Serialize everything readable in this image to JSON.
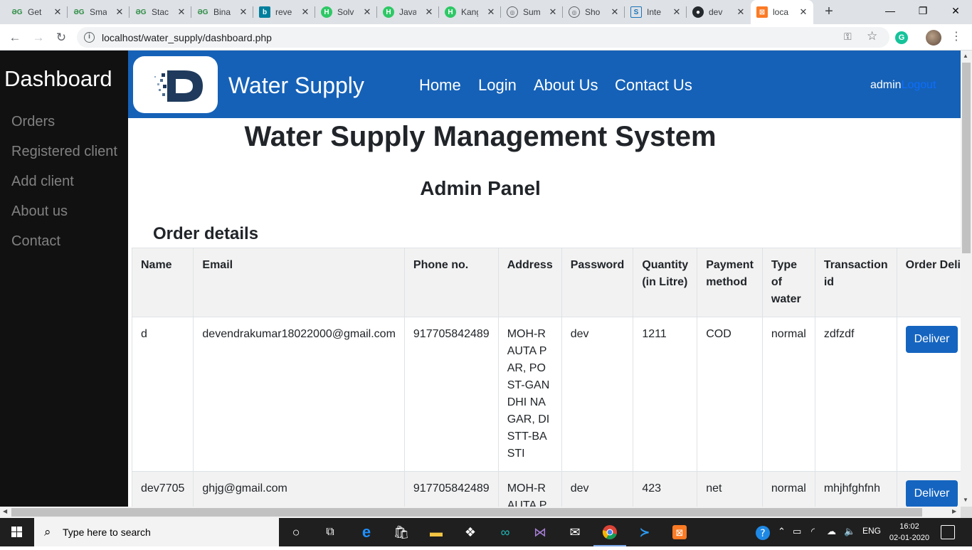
{
  "browser": {
    "tabs": [
      {
        "title": "Get",
        "icon": "geeksforgeeks-icon"
      },
      {
        "title": "Sma",
        "icon": "geeksforgeeks-icon"
      },
      {
        "title": "Stac",
        "icon": "geeksforgeeks-icon"
      },
      {
        "title": "Bina",
        "icon": "geeksforgeeks-icon"
      },
      {
        "title": "reve",
        "icon": "bing-icon"
      },
      {
        "title": "Solv",
        "icon": "hackerrank-icon"
      },
      {
        "title": "Java",
        "icon": "hackerrank-icon"
      },
      {
        "title": "Kang",
        "icon": "hackerrank-icon"
      },
      {
        "title": "Sum",
        "icon": "globe-icon"
      },
      {
        "title": "Sho",
        "icon": "globe-icon"
      },
      {
        "title": "Inte",
        "icon": "interviewbit-icon"
      },
      {
        "title": "dev",
        "icon": "github-icon"
      },
      {
        "title": "loca",
        "icon": "xampp-icon"
      }
    ],
    "url": "localhost/water_supply/dashboard.php"
  },
  "sidebar": {
    "brand": "Dashboard",
    "items": [
      "Orders",
      "Registered client",
      "Add client",
      "About us",
      "Contact"
    ]
  },
  "header": {
    "site_title": "Water Supply",
    "nav": [
      "Home",
      "Login",
      "About Us",
      "Contact Us"
    ],
    "user": "admin",
    "logout": "Logout"
  },
  "main": {
    "title": "Water Supply Management System",
    "panel_title": "Admin Panel",
    "section_title": "Order details"
  },
  "orders": {
    "columns": [
      "Name",
      "Email",
      "Phone no.",
      "Address",
      "Password",
      "Quantity (in Litre)",
      "Payment method",
      "Type of water",
      "Transaction id",
      "Order Deliverd"
    ],
    "rows": [
      {
        "name": "d",
        "email": "devendrakumar18022000@gmail.com",
        "phone": "917705842489",
        "address": "MOH-RAUTA PAR, POST-GANDHI NAGAR, DISTT-BASTI",
        "password": "dev",
        "quantity": "1211",
        "payment": "COD",
        "water_type": "normal",
        "transaction": "zdfzdf",
        "action": "Deliver"
      },
      {
        "name": "dev7705",
        "email": "ghjg@gmail.com",
        "phone": "917705842489",
        "address": "MOH-RAUTA PAR",
        "password": "dev",
        "quantity": "423",
        "payment": "net",
        "water_type": "normal",
        "transaction": "mhjhfghfnh",
        "action": "Deliver"
      }
    ]
  },
  "taskbar": {
    "search_placeholder": "Type here to search",
    "language": "ENG",
    "time": "16:02",
    "date": "02-01-2020"
  },
  "colors": {
    "header_bg": "#1561b7",
    "sidebar_bg": "#111111",
    "button_bg": "#1565c0"
  }
}
